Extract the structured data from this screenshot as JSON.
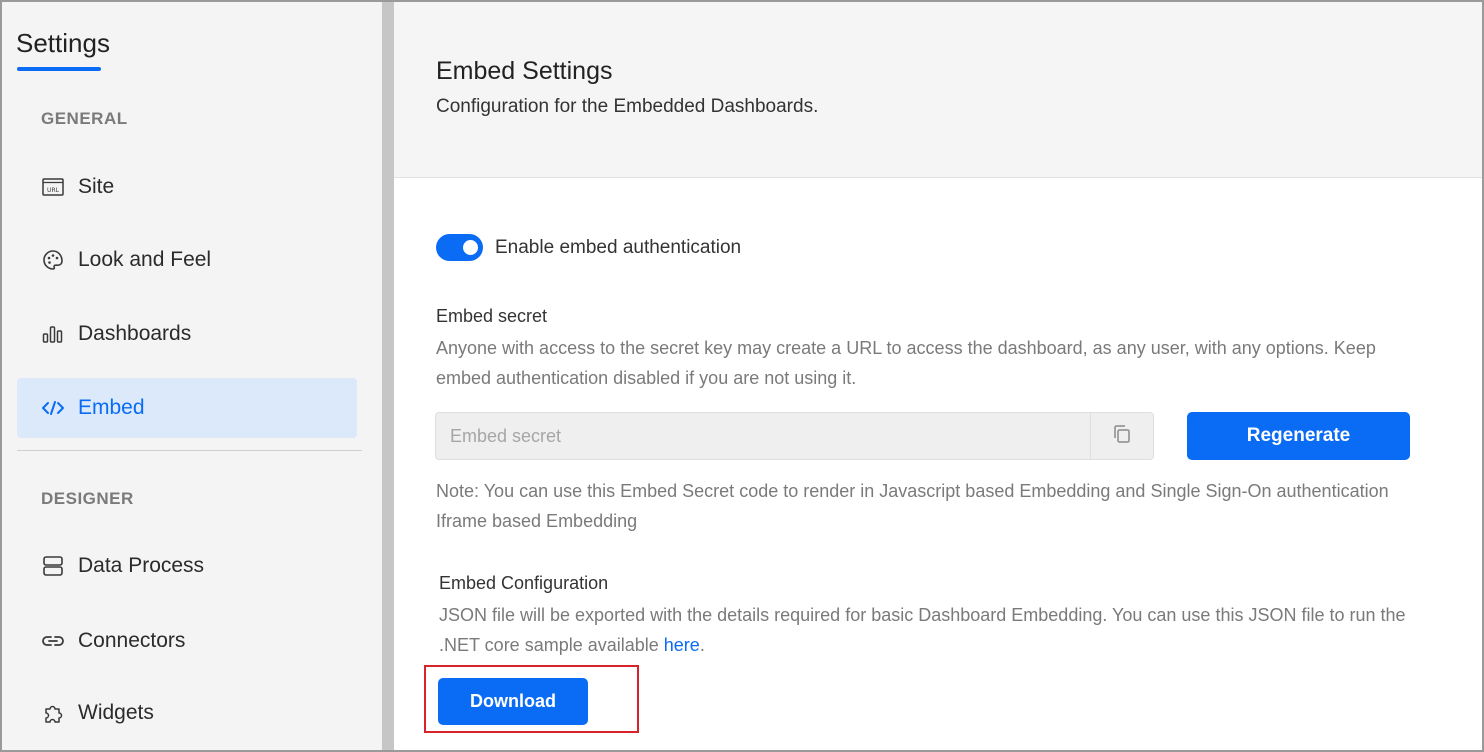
{
  "sidebar": {
    "title": "Settings",
    "sections": {
      "general": "GENERAL",
      "designer": "DESIGNER"
    },
    "items": [
      {
        "label": "Site",
        "icon": "url-icon",
        "active": false
      },
      {
        "label": "Look and Feel",
        "icon": "palette-icon",
        "active": false
      },
      {
        "label": "Dashboards",
        "icon": "bar-chart-icon",
        "active": false
      },
      {
        "label": "Embed",
        "icon": "code-icon",
        "active": true
      },
      {
        "label": "Data Process",
        "icon": "database-icon",
        "active": false
      },
      {
        "label": "Connectors",
        "icon": "link-icon",
        "active": false
      },
      {
        "label": "Widgets",
        "icon": "puzzle-icon",
        "active": false
      }
    ]
  },
  "header": {
    "title": "Embed Settings",
    "subtitle": "Configuration for the Embedded Dashboards."
  },
  "embed_auth": {
    "label": "Enable embed authentication",
    "enabled": true
  },
  "secret": {
    "heading": "Embed secret",
    "description": "Anyone with access to the secret key may create a URL to access the dashboard, as any user, with any options. Keep embed authentication disabled if you are not using it.",
    "placeholder": "Embed secret",
    "value": "",
    "regenerate_label": "Regenerate",
    "note": "Note: You can use this Embed Secret code to render in Javascript based Embedding and Single Sign-On authentication Iframe based Embedding"
  },
  "config": {
    "heading": "Embed Configuration",
    "description": "JSON file will be exported with the details required for basic Dashboard Embedding. You can use this JSON file to run the .NET core sample available ",
    "link_text": "here",
    "trailing": ".",
    "download_label": "Download"
  },
  "colors": {
    "accent": "#0a6cf5",
    "active_bg": "#dbe9fb",
    "highlight": "#d9232a"
  }
}
